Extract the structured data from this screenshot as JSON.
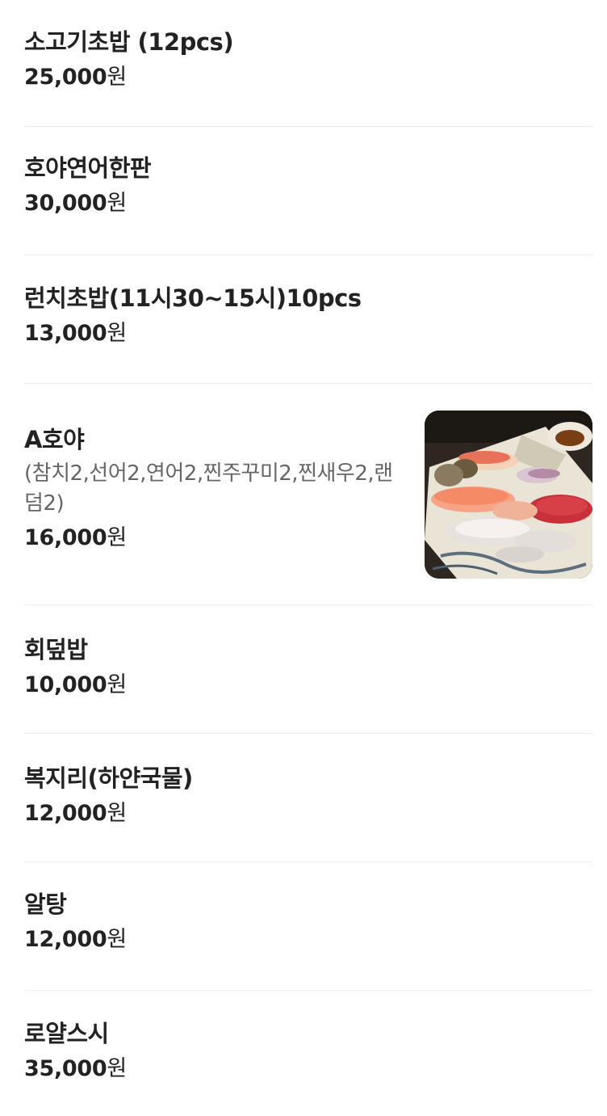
{
  "menu": {
    "items": [
      {
        "name": "소고기초밥 (12pcs)",
        "price": "25,000",
        "unit": "원"
      },
      {
        "name": "호야연어한판",
        "price": "30,000",
        "unit": "원"
      },
      {
        "name": "런치초밥(11시30~15시)10pcs",
        "price": "13,000",
        "unit": "원"
      },
      {
        "name": "A호야",
        "description": "(참치2,선어2,연어2,찐주꾸미2,찐새우2,랜덤2)",
        "price": "16,000",
        "unit": "원",
        "image": "sushi-platter-photo"
      },
      {
        "name": "회덮밥",
        "price": "10,000",
        "unit": "원"
      },
      {
        "name": "복지리(하얀국물)",
        "price": "12,000",
        "unit": "원"
      },
      {
        "name": "알탕",
        "price": "12,000",
        "unit": "원"
      },
      {
        "name": "로얄스시",
        "price": "35,000",
        "unit": "원"
      }
    ]
  }
}
